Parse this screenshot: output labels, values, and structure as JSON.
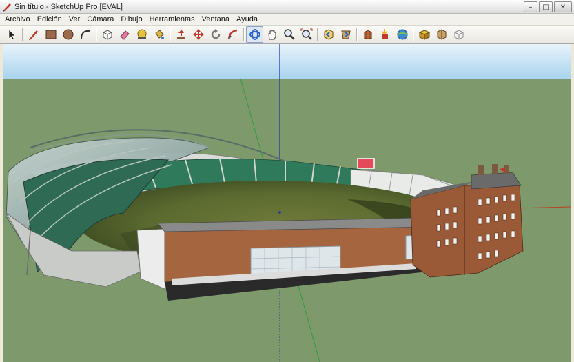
{
  "window": {
    "title": "Sin título - SketchUp Pro [EVAL]",
    "controls": {
      "minimize": "–",
      "maximize": "□",
      "close": "✕"
    }
  },
  "menu": [
    "Archivo",
    "Edición",
    "Ver",
    "Cámara",
    "Dibujo",
    "Herramientas",
    "Ventana",
    "Ayuda"
  ],
  "toolbar": {
    "tools": [
      "select-icon",
      "pencil-icon",
      "rectangle-icon",
      "circle-icon",
      "arc-icon",
      "make-component-icon",
      "eraser-icon",
      "tape-measure-icon",
      "paint-bucket-icon",
      "push-pull-icon",
      "move-icon",
      "rotate-icon",
      "follow-me-icon",
      "orbit-icon",
      "pan-icon",
      "zoom-icon",
      "zoom-extents-icon",
      "previous-view-icon",
      "next-view-icon",
      "place-model-icon",
      "get-models-icon",
      "share-model-icon",
      "components-icon",
      "styles-icon",
      "add-location-icon"
    ],
    "active_tool": "orbit-icon"
  },
  "colors": {
    "sky_top": "#e8f3fb",
    "sky_bottom": "#a9d3ee",
    "ground": "#7e9a6c",
    "axis_red": "#b8421f",
    "axis_green": "#2f9a3a",
    "axis_blue": "#1c2ea8"
  }
}
